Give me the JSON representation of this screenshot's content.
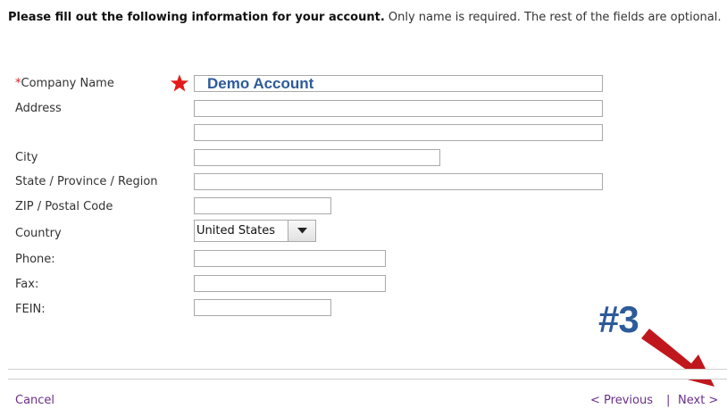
{
  "intro": {
    "bold": "Please fill out the following information for your account.",
    "rest": " Only name is required. The rest of the fields are optional."
  },
  "form": {
    "company": {
      "required_mark": "*",
      "label": "Company Name",
      "value": "Demo Account"
    },
    "address": {
      "label": "Address",
      "value1": "",
      "value2": ""
    },
    "city": {
      "label": "City",
      "value": ""
    },
    "state": {
      "label": "State / Province / Region",
      "value": ""
    },
    "zip": {
      "label": "ZIP / Postal Code",
      "value": ""
    },
    "country": {
      "label": "Country",
      "value": "United States"
    },
    "phone": {
      "label": "Phone:",
      "value": ""
    },
    "fax": {
      "label": "Fax:",
      "value": ""
    },
    "fein": {
      "label": "FEIN:",
      "value": ""
    }
  },
  "annotation": {
    "label": "#3"
  },
  "footer": {
    "cancel": "Cancel",
    "previous": "< Previous",
    "separator": "|",
    "next": "Next >"
  },
  "colors": {
    "link": "#6b2f8a",
    "required": "#cc2222",
    "annotation_text": "#2d5b9a",
    "annotation_arrow": "#c0171d"
  },
  "icons": [
    "star-icon",
    "chevron-down-icon",
    "arrow-icon"
  ]
}
